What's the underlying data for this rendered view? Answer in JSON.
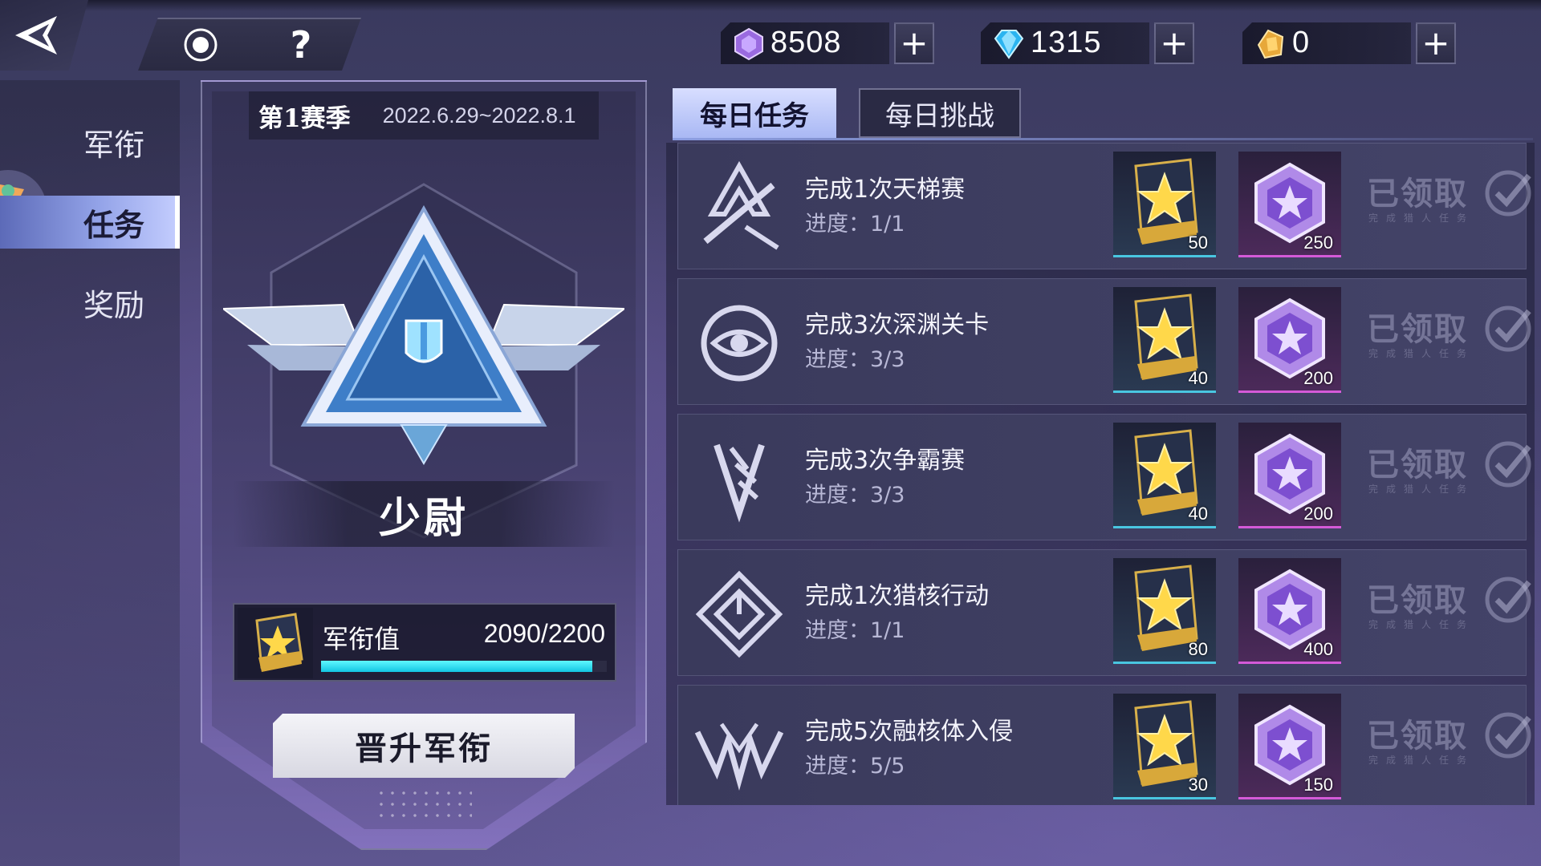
{
  "topbar": {
    "currencies": [
      {
        "icon": "purple-gem-icon",
        "value": "8508",
        "plus": "+"
      },
      {
        "icon": "blue-diamond-icon",
        "value": "1315",
        "plus": "+"
      },
      {
        "icon": "gold-crystal-icon",
        "value": "0",
        "plus": "+"
      }
    ],
    "help_label": "?"
  },
  "sidebar": {
    "items": [
      {
        "label": "军衔",
        "active": false
      },
      {
        "label": "任务",
        "active": true
      },
      {
        "label": "奖励",
        "active": false
      }
    ]
  },
  "rank_panel": {
    "season_title": "第1赛季",
    "season_dates": "2022.6.29~2022.8.1",
    "rank_name": "少尉",
    "exp_label": "军衔值",
    "exp_value": "2090/2200",
    "exp_progress": 0.95,
    "promote_label": "晋升军衔"
  },
  "tabs": [
    {
      "label": "每日任务",
      "active": true
    },
    {
      "label": "每日挑战",
      "active": false
    }
  ],
  "tasks": [
    {
      "icon": "sword-icon",
      "title": "完成1次天梯赛",
      "progress": "进度：1/1",
      "reward_a": "50",
      "reward_b": "250",
      "status": "已领取",
      "status_sub": "完成猎人任务"
    },
    {
      "icon": "abyss-eye-icon",
      "title": "完成3次深渊关卡",
      "progress": "进度：3/3",
      "reward_a": "40",
      "reward_b": "200",
      "status": "已领取",
      "status_sub": "完成猎人任务"
    },
    {
      "icon": "claw-shield-icon",
      "title": "完成3次争霸赛",
      "progress": "进度：3/3",
      "reward_a": "40",
      "reward_b": "200",
      "status": "已领取",
      "status_sub": "完成猎人任务"
    },
    {
      "icon": "spiral-core-icon",
      "title": "完成1次猎核行动",
      "progress": "进度：1/1",
      "reward_a": "80",
      "reward_b": "400",
      "status": "已领取",
      "status_sub": "完成猎人任务"
    },
    {
      "icon": "fusion-claw-icon",
      "title": "完成5次融核体入侵",
      "progress": "进度：5/5",
      "reward_a": "30",
      "reward_b": "150",
      "status": "已领取",
      "status_sub": "完成猎人任务"
    }
  ],
  "colors": {
    "accent_cyan": "#13c6e2",
    "tab_active": "#a9b8f4",
    "reward_card_border": "#49c6e0",
    "reward_gem_border": "#d45ad8"
  }
}
